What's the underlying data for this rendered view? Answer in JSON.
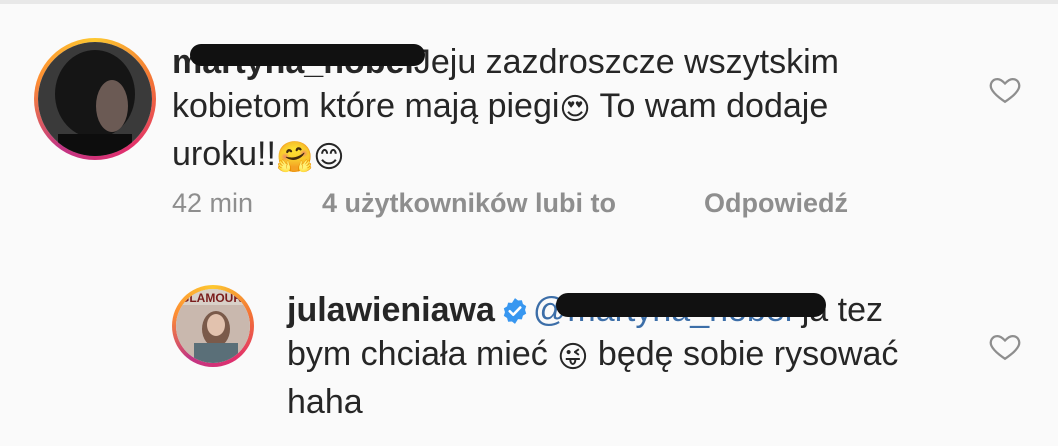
{
  "comments": [
    {
      "username": "martyna_nobel",
      "text": "Jeju zazdroszcze wszytskim kobietom które mają piegi",
      "emoji1": "😍",
      "text2": " To wam dodaje uroku!!",
      "emoji2": "🤗😊",
      "time": "42 min",
      "likes": "4 użytkowników lubi to",
      "reply": "Odpowiedź"
    },
    {
      "username": "julawieniawa",
      "mention": "@martyna_nobel",
      "text": " ja tez bym chciała mieć ",
      "emoji1": "😜",
      "text2": " będę sobie rysować haha"
    }
  ],
  "icons": {
    "heart": "heart-outline-icon",
    "verified": "verified-badge-icon"
  },
  "colors": {
    "mention": "#3c6ea8",
    "verified": "#3897f0",
    "meta": "#8e8e8e"
  }
}
